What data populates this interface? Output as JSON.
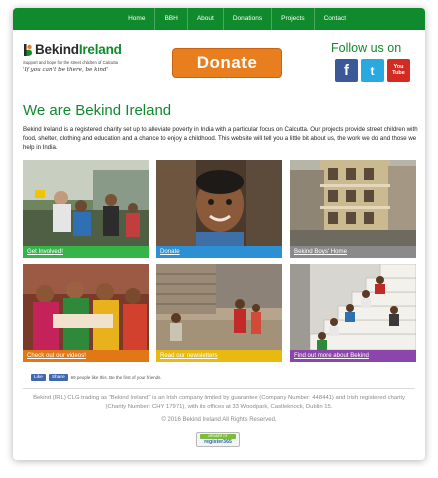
{
  "nav": {
    "items": [
      "Home",
      "BBH",
      "About",
      "Donations",
      "Projects",
      "Contact"
    ]
  },
  "logo": {
    "brand_a": "Bekind",
    "brand_b": "Ireland",
    "subtitle": "Support and hope for the street children of Calcutta",
    "tagline": "'If you can't be there, be kind'"
  },
  "donate": {
    "label": "Donate"
  },
  "follow": {
    "title": "Follow us on",
    "facebook_glyph": "f",
    "twitter_glyph": "t",
    "youtube_top": "You",
    "youtube_bottom": "Tube",
    "icons": [
      "facebook-icon",
      "twitter-icon",
      "youtube-icon"
    ]
  },
  "main": {
    "heading": "We are Bekind Ireland",
    "intro": "Bekind Ireland is a registered charity set up to alleviate poverty in India with a particular focus on Calcutta. Our projects provide street children with food, shelter, clothing and education and a chance to enjoy a childhood. This website will tell you a little bit about us, the work we do and those we help in India."
  },
  "tiles": [
    {
      "caption": "Get Involved!",
      "color": "#35b44a"
    },
    {
      "caption": "Donate",
      "color": "#2e90d4"
    },
    {
      "caption": "Bekind Boys' Home",
      "color": "#8a8a8a"
    },
    {
      "caption": "Check out our videos!",
      "color": "#e07818"
    },
    {
      "caption": "Read our newsletters",
      "color": "#e8b90f"
    },
    {
      "caption": "Find out more about Bekind",
      "color": "#8b46ab"
    }
  ],
  "social_like": {
    "like_label": "Like",
    "share_label": "Share",
    "text": "69 people like this. Be the first of your friends."
  },
  "footer": {
    "company": "Bekind (IRL) CLG trading as \"Bekind Ireland\" is an Irish company limited by guarantee (Company Number: 448441) and Irish registered charity (Charity Number: CHY 17971), with its offices at 33 Woodpark, Castleknock, Dublin 15.",
    "copyright": "© 2016 Bekind Ireland All Rights Reserved.",
    "badge_top": "MEMBER OF",
    "badge_main": "register365"
  },
  "colors": {
    "brand_green": "#0f8a2c",
    "donate_orange": "#e97e1f"
  }
}
